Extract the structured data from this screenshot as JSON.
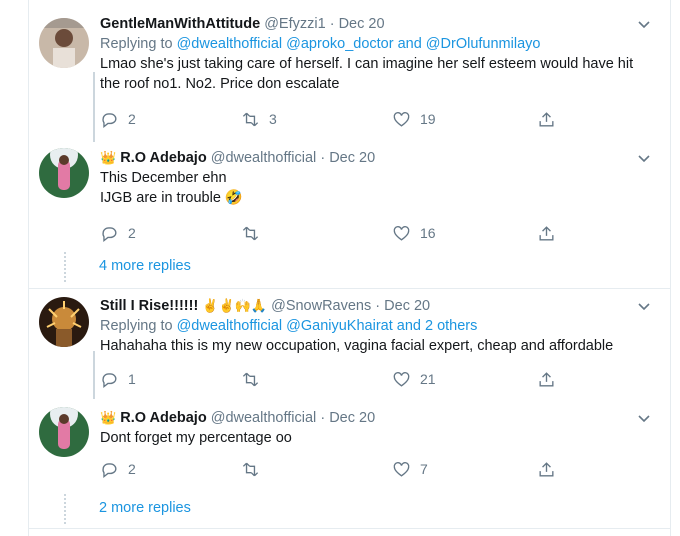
{
  "tweets": [
    {
      "name": "GentleManWithAttitude",
      "name_emoji": "",
      "handle": "@Efyzzi1",
      "date": "Dec 20",
      "replying_prefix": "Replying to",
      "replying_to": "@dwealthofficial @aproko_doctor and @DrOlufunmilayo",
      "text": "Lmao she's just taking care of herself. I can imagine her self esteem would have hit the roof no1. No2. Price don escalate",
      "replies": "2",
      "retweets": "3",
      "likes": "19"
    },
    {
      "name": "R.O Adebajo",
      "name_emoji": "👑",
      "handle": "@dwealthofficial",
      "date": "Dec 20",
      "text_line1": "This December ehn",
      "text_line2": "IJGB are in trouble 🤣",
      "replies": "2",
      "retweets": "",
      "likes": "16"
    },
    {
      "name": "Still I Rise!!!!!!",
      "name_emoji": "✌️✌️🙌🙏",
      "handle": "@SnowRavens",
      "date": "Dec 20",
      "replying_prefix": "Replying to",
      "replying_to": "@dwealthofficial @GaniyuKhairat and 2 others",
      "text": "Hahahaha this is my new occupation, vagina facial expert, cheap and affordable",
      "replies": "1",
      "retweets": "",
      "likes": "21"
    },
    {
      "name": "R.O Adebajo",
      "name_emoji": "👑",
      "handle": "@dwealthofficial",
      "date": "Dec 20",
      "text": "Dont forget my percentage oo",
      "replies": "2",
      "retweets": "",
      "likes": "7"
    }
  ],
  "more_replies": [
    "4 more replies",
    "2 more replies"
  ],
  "colors": {
    "link": "#1b95e0",
    "secondary": "#657786",
    "border": "#e6ecf0"
  },
  "icons": [
    "reply-icon",
    "retweet-icon",
    "like-icon",
    "share-icon",
    "chevron-down-icon"
  ]
}
